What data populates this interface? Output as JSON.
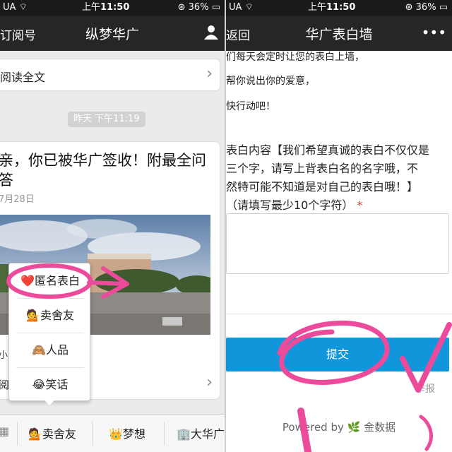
{
  "left": {
    "status": {
      "carrier": "UA",
      "time": "11:50",
      "time_prefix": "上午",
      "battery": "36%"
    },
    "nav": {
      "back": "订阅号",
      "title": "纵梦华广"
    },
    "read_full": "阅读全文",
    "time_badge": "昨天 下午11:19",
    "article": {
      "title": "亲，你已被华广签收！附最全问答",
      "date": "7月28日",
      "excerpt": "小                    来!",
      "readmore": "阅"
    },
    "popup": {
      "items": [
        {
          "emoji": "❤️",
          "label": "匿名表白"
        },
        {
          "emoji": "💁",
          "label": "卖舍友"
        },
        {
          "emoji": "🙈",
          "label": "人品"
        },
        {
          "emoji": "😂",
          "label": "笑话"
        }
      ]
    },
    "menu": {
      "items": [
        {
          "emoji": "💁",
          "label": "卖舍友"
        },
        {
          "emoji": "👑",
          "label": "梦想"
        },
        {
          "emoji": "🏢",
          "label": "大华广"
        }
      ]
    }
  },
  "right": {
    "status": {
      "carrier": "UA",
      "time": "11:50",
      "time_prefix": "上午",
      "battery": "36%"
    },
    "nav": {
      "back": "返回",
      "title": "华广表白墙",
      "more": "•••"
    },
    "intro": [
      "们每天会定时让您的表白上墙，",
      "帮你说出你的爱意，",
      "快行动吧！"
    ],
    "label_line1": "表白内容【我们希望真诚的表白不仅仅是",
    "label_line2": "三个字，请写上背表白名的名字哦，不",
    "label_line3": "然特可能不知道是对自己的表白哦！】",
    "label_hint": "（请填写最少10个字符）",
    "required_mark": "*",
    "submit": "提交",
    "report": "举报",
    "footer": "Powered by 🌿 金数据"
  },
  "colors": {
    "accent": "#1296db",
    "annotation": "#ec4a9b",
    "navbar": "#262626"
  }
}
